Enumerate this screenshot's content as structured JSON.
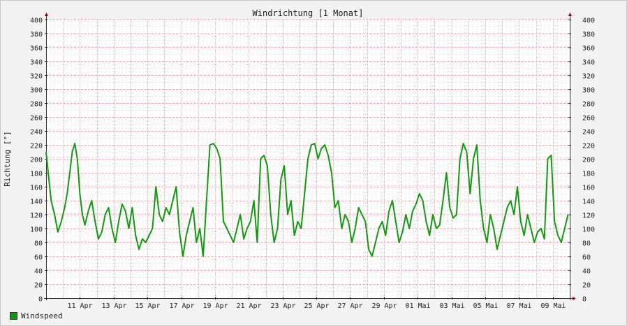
{
  "chart_data": {
    "type": "line",
    "title": "Windrichtung [1 Monat]",
    "ylabel": "Richtung [°]",
    "ylim": [
      0,
      400
    ],
    "yticks": [
      0,
      20,
      40,
      60,
      80,
      100,
      120,
      140,
      160,
      180,
      200,
      220,
      240,
      260,
      280,
      300,
      320,
      340,
      360,
      380,
      400
    ],
    "xlim": [
      0,
      31
    ],
    "xticks": [
      {
        "x": 2,
        "label": "11 Apr"
      },
      {
        "x": 4,
        "label": "13 Apr"
      },
      {
        "x": 6,
        "label": "15 Apr"
      },
      {
        "x": 8,
        "label": "17 Apr"
      },
      {
        "x": 10,
        "label": "19 Apr"
      },
      {
        "x": 12,
        "label": "21 Apr"
      },
      {
        "x": 14,
        "label": "23 Apr"
      },
      {
        "x": 16,
        "label": "25 Apr"
      },
      {
        "x": 18,
        "label": "27 Apr"
      },
      {
        "x": 20,
        "label": "29 Apr"
      },
      {
        "x": 22,
        "label": "01 Mai"
      },
      {
        "x": 24,
        "label": "03 Mai"
      },
      {
        "x": 26,
        "label": "05 Mai"
      },
      {
        "x": 28,
        "label": "07 Mai"
      },
      {
        "x": 30,
        "label": "09 Mai"
      }
    ],
    "grid": true,
    "legend": "bottom-left",
    "series": [
      {
        "name": "Windspeed",
        "color": "#119911",
        "x": [
          0.0,
          0.15,
          0.3,
          0.5,
          0.7,
          0.9,
          1.1,
          1.25,
          1.4,
          1.55,
          1.7,
          1.85,
          2.0,
          2.15,
          2.3,
          2.5,
          2.7,
          2.9,
          3.1,
          3.3,
          3.5,
          3.7,
          3.9,
          4.1,
          4.3,
          4.5,
          4.7,
          4.9,
          5.1,
          5.3,
          5.5,
          5.7,
          5.9,
          6.1,
          6.3,
          6.5,
          6.7,
          6.9,
          7.1,
          7.3,
          7.5,
          7.7,
          7.9,
          8.1,
          8.3,
          8.5,
          8.7,
          8.9,
          9.1,
          9.3,
          9.5,
          9.7,
          9.9,
          10.1,
          10.3,
          10.5,
          10.7,
          10.9,
          11.1,
          11.3,
          11.5,
          11.7,
          11.9,
          12.1,
          12.3,
          12.5,
          12.7,
          12.9,
          13.1,
          13.3,
          13.5,
          13.7,
          13.9,
          14.1,
          14.3,
          14.5,
          14.7,
          14.9,
          15.1,
          15.3,
          15.5,
          15.7,
          15.9,
          16.1,
          16.3,
          16.5,
          16.7,
          16.9,
          17.1,
          17.3,
          17.5,
          17.7,
          17.9,
          18.1,
          18.3,
          18.5,
          18.7,
          18.9,
          19.1,
          19.3,
          19.5,
          19.7,
          19.9,
          20.1,
          20.3,
          20.5,
          20.7,
          20.9,
          21.1,
          21.3,
          21.5,
          21.7,
          21.9,
          22.1,
          22.3,
          22.5,
          22.7,
          22.9,
          23.1,
          23.3,
          23.5,
          23.7,
          23.9,
          24.1,
          24.3,
          24.5,
          24.7,
          24.9,
          25.1,
          25.3,
          25.5,
          25.7,
          25.9,
          26.1,
          26.3,
          26.5,
          26.7,
          26.9,
          27.1,
          27.3,
          27.5,
          27.7,
          27.9,
          28.1,
          28.3,
          28.5,
          28.7,
          28.9,
          29.1,
          29.3,
          29.5,
          29.7,
          29.9,
          30.1,
          30.3,
          30.5,
          30.7,
          30.9
        ],
        "values": [
          210,
          175,
          140,
          120,
          95,
          110,
          130,
          150,
          180,
          210,
          222,
          200,
          150,
          120,
          105,
          125,
          140,
          110,
          85,
          95,
          120,
          130,
          100,
          80,
          110,
          135,
          125,
          100,
          130,
          90,
          70,
          85,
          80,
          90,
          100,
          160,
          120,
          110,
          130,
          120,
          140,
          160,
          95,
          60,
          90,
          110,
          130,
          80,
          100,
          60,
          140,
          220,
          222,
          215,
          200,
          110,
          100,
          90,
          80,
          100,
          120,
          85,
          100,
          110,
          140,
          80,
          200,
          205,
          190,
          120,
          80,
          100,
          170,
          190,
          120,
          140,
          90,
          110,
          100,
          150,
          200,
          220,
          222,
          200,
          215,
          220,
          205,
          180,
          130,
          140,
          100,
          120,
          110,
          80,
          100,
          130,
          120,
          110,
          70,
          60,
          80,
          100,
          110,
          90,
          125,
          140,
          110,
          80,
          95,
          120,
          100,
          125,
          135,
          150,
          140,
          110,
          90,
          120,
          100,
          105,
          140,
          180,
          130,
          115,
          120,
          200,
          222,
          210,
          150,
          200,
          220,
          140,
          100,
          80,
          120,
          100,
          70,
          90,
          110,
          130,
          140,
          120,
          160,
          110,
          90,
          120,
          100,
          80,
          95,
          100,
          85,
          200,
          205,
          110,
          90,
          80,
          100,
          120
        ]
      }
    ]
  }
}
